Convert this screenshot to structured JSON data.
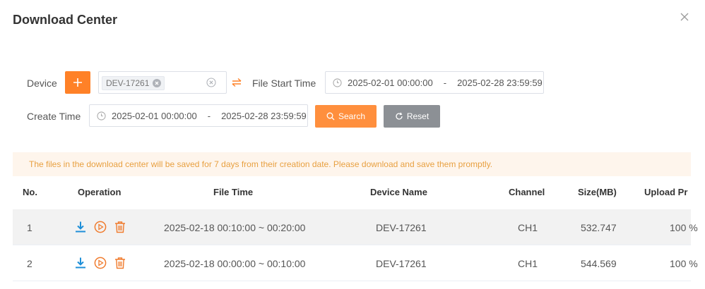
{
  "dialog": {
    "title": "Download Center"
  },
  "filters": {
    "device_label": "Device",
    "device_tag": "DEV-17261",
    "file_start_time_label": "File Start Time",
    "file_start": "2025-02-01 00:00:00",
    "file_end": "2025-02-28 23:59:59",
    "create_time_label": "Create Time",
    "create_start": "2025-02-01 00:00:00",
    "create_end": "2025-02-28 23:59:59",
    "range_sep": "-",
    "search_label": "Search",
    "reset_label": "Reset"
  },
  "notice": "The files in the download center will be saved for 7 days from their creation date. Please download and save them promptly.",
  "table": {
    "headers": [
      "No.",
      "Operation",
      "File Time",
      "Device Name",
      "Channel",
      "Size(MB)",
      "Upload Pr"
    ],
    "rows": [
      {
        "no": "1",
        "file_time": "2025-02-18 00:10:00 ~ 00:20:00",
        "device": "DEV-17261",
        "channel": "CH1",
        "size": "532.747",
        "upload": "100 %"
      },
      {
        "no": "2",
        "file_time": "2025-02-18 00:00:00 ~ 00:10:00",
        "device": "DEV-17261",
        "channel": "CH1",
        "size": "544.569",
        "upload": "100 %"
      }
    ]
  },
  "icons": {
    "close": "close-icon",
    "add": "plus-icon",
    "swap": "swap-icon",
    "clock": "clock-icon",
    "search": "search-icon",
    "reset": "refresh-icon",
    "download": "download-icon",
    "play": "play-icon",
    "delete": "trash-icon"
  },
  "colors": {
    "accent": "#ff8127",
    "download_icon": "#1e8fd8",
    "action_icon": "#f07b2d",
    "notice_bg": "#fef5ec",
    "notice_text": "#e8a040"
  }
}
